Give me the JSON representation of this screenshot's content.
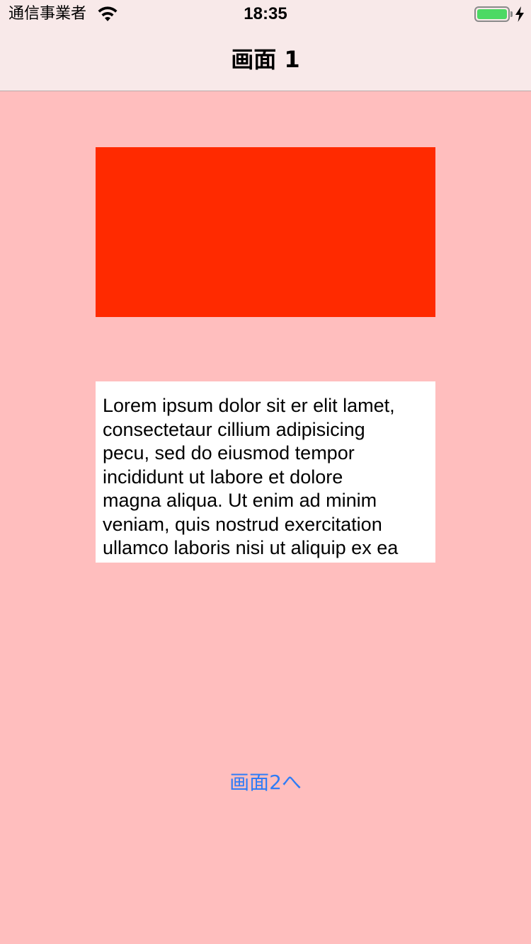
{
  "status_bar": {
    "carrier": "通信事業者",
    "time": "18:35",
    "wifi_icon": "wifi-icon",
    "battery_icon": "battery-icon",
    "charging_icon": "charging-bolt-icon",
    "battery_level": 1.0
  },
  "nav": {
    "title": "画面 1"
  },
  "content": {
    "red_box_color": "#ff2a00",
    "text": "Lorem ipsum dolor sit er elit lamet,\nconsectetaur cillium adipisicing\npecu, sed do eiusmod tempor\nincididunt ut labore et dolore\nmagna aliqua. Ut enim ad minim\nveniam, quis nostrud exercitation\nullamco laboris nisi ut aliquip ex ea",
    "button_label": "画面2へ",
    "button_color": "#2f7cf6"
  },
  "colors": {
    "background": "#ffbebe",
    "bar_background": "#f8e9e9",
    "battery_green": "#4cd964"
  }
}
